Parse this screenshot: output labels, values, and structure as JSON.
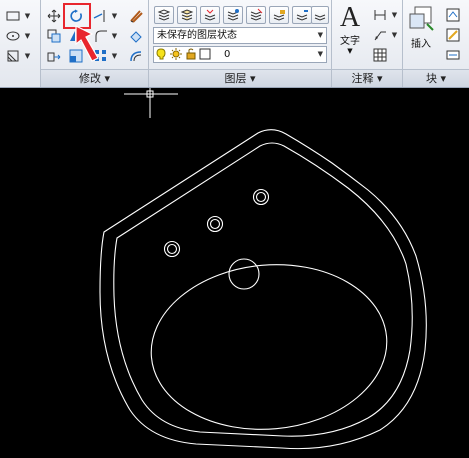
{
  "panels": {
    "modify": {
      "title": "修改"
    },
    "layers": {
      "title": "图层",
      "layer_state": "未保存的图层状态",
      "layer_name": "0"
    },
    "annotation": {
      "title": "注释",
      "text_label": "文字"
    },
    "block": {
      "title": "块",
      "insert_label": "插入"
    }
  },
  "icons": [
    "move-icon",
    "rotate-icon",
    "trim-icon",
    "erase-icon",
    "copy-icon",
    "mirror-icon",
    "fillet-icon",
    "stretch-icon",
    "scale-icon",
    "array-icon",
    "offset-icon",
    "layer-properties-icon",
    "layer-icons",
    "lightbulb-icon",
    "sun-icon",
    "lock-icon",
    "color-swatch",
    "text-icon",
    "linear-dimension-icon",
    "leader-icon",
    "table-icon",
    "insert-icon",
    "create-block-icon",
    "edit-block-icon",
    "attribute-icon"
  ],
  "colors": {
    "highlight": "#e8262e",
    "arrow": "#e8262e",
    "canvas": "#000000",
    "drawing": "#ffffff",
    "ribbon": "#e3e7ee"
  }
}
